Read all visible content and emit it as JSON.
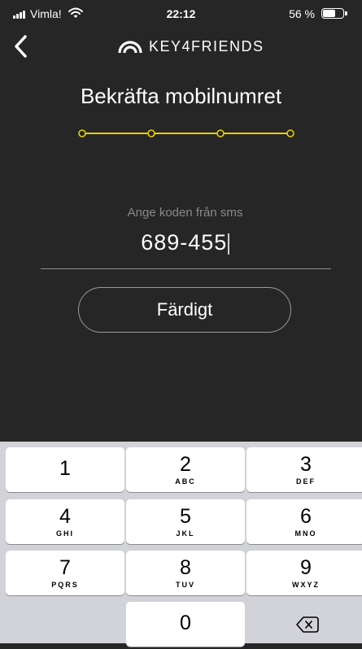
{
  "status_bar": {
    "carrier": "Vimla!",
    "time": "22:12",
    "battery": "56 %",
    "battery_level": 0.56
  },
  "nav": {
    "back_icon": "chevron-left-icon",
    "brand_logo_icon": "arch-logo-icon",
    "brand": "KEY4FRIENDS"
  },
  "title": "Bekräfta mobilnumret",
  "progress": {
    "steps": 4,
    "icon": "progress-dots",
    "color": "#e6d200"
  },
  "sms": {
    "label": "Ange koden från sms",
    "code": "689-455"
  },
  "done_button": "Färdigt",
  "keyboard": {
    "keys": [
      {
        "number": "1",
        "letters": ""
      },
      {
        "number": "2",
        "letters": "ABC"
      },
      {
        "number": "3",
        "letters": "DEF"
      },
      {
        "number": "4",
        "letters": "GHI"
      },
      {
        "number": "5",
        "letters": "JKL"
      },
      {
        "number": "6",
        "letters": "MNO"
      },
      {
        "number": "7",
        "letters": "PQRS"
      },
      {
        "number": "8",
        "letters": "TUV"
      },
      {
        "number": "9",
        "letters": "WXYZ"
      },
      {
        "number": "0",
        "letters": ""
      }
    ],
    "delete_icon": "backspace-icon"
  },
  "colors": {
    "background": "#262626",
    "accent": "#e6d200",
    "keyboard": "#d2d3d8"
  }
}
